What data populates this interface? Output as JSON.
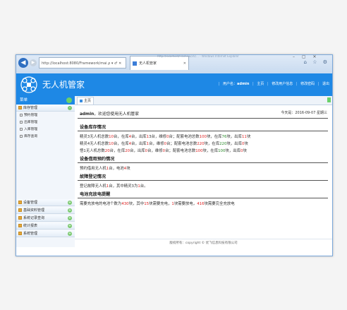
{
  "browser": {
    "address": "http://localhost:8080/Framework/mai ρ ▾ ♂ ✕",
    "tab_title": "无人机管家",
    "window_title": "http://localhost/Framework/... - Windows Internet Explorer",
    "tools_icons": "⌂ ☆ ⚙",
    "window_controls": "– ▢ ✕"
  },
  "header": {
    "app_title": "无人机管家",
    "nav": {
      "user_label": "用户名：",
      "user_name": "admin",
      "home": "主页",
      "edit_info": "修改用户信息",
      "change_password": "修改密码",
      "logout": "退出"
    },
    "brand_color": "#1e88e5"
  },
  "sidebar": {
    "title": "菜单",
    "groups": [
      {
        "label": "库存管理",
        "expanded": true,
        "items": [
          "预约管理",
          "出库管理",
          "入库管理",
          "库存查询"
        ]
      },
      {
        "label": "设备管理"
      },
      {
        "label": "基础资料管理"
      },
      {
        "label": "系统记录查询"
      },
      {
        "label": "统计报表"
      },
      {
        "label": "系统管理"
      }
    ]
  },
  "tabs": [
    {
      "label": "主页"
    }
  ],
  "welcome": {
    "user": "admin",
    "text": "，欢迎您使用无人机管家"
  },
  "today": "今天是：2016-09-07 星期三",
  "sections": {
    "stock": {
      "title": "设备库存情况",
      "lines": [
        [
          {
            "t": "精灵3无人机总数"
          },
          {
            "t": "10",
            "c": "r"
          },
          {
            "t": "台，在库"
          },
          {
            "t": "4",
            "c": "r"
          },
          {
            "t": "台，出库"
          },
          {
            "t": "1",
            "c": "r"
          },
          {
            "t": "3台，维修"
          },
          {
            "t": "0",
            "c": "r"
          },
          {
            "t": "台；配套电池总数"
          },
          {
            "t": "100",
            "c": "r"
          },
          {
            "t": "块，在库"
          },
          {
            "t": "76",
            "c": "g"
          },
          {
            "t": "块，出库"
          },
          {
            "t": "11",
            "c": "r"
          },
          {
            "t": "块"
          }
        ],
        [
          {
            "t": "精灵4无人机总数"
          },
          {
            "t": "10",
            "c": "r"
          },
          {
            "t": "台，在库"
          },
          {
            "t": "4",
            "c": "r"
          },
          {
            "t": "台，出库"
          },
          {
            "t": "1",
            "c": "r"
          },
          {
            "t": "台，维修"
          },
          {
            "t": "0",
            "c": "r"
          },
          {
            "t": "台；配套电池总数"
          },
          {
            "t": "220",
            "c": "r"
          },
          {
            "t": "块，在库"
          },
          {
            "t": "220",
            "c": "g"
          },
          {
            "t": "块，出库"
          },
          {
            "t": "0",
            "c": "r"
          },
          {
            "t": "块"
          }
        ],
        [
          {
            "t": "悟1无人机总数"
          },
          {
            "t": "20",
            "c": "r"
          },
          {
            "t": "台，在库"
          },
          {
            "t": "20",
            "c": "r"
          },
          {
            "t": "台，出库"
          },
          {
            "t": "0",
            "c": "r"
          },
          {
            "t": "台，维修"
          },
          {
            "t": "0",
            "c": "r"
          },
          {
            "t": "台；配套电池总数"
          },
          {
            "t": "100",
            "c": "r"
          },
          {
            "t": "块，在库"
          },
          {
            "t": "100",
            "c": "g"
          },
          {
            "t": "块，出库"
          },
          {
            "t": "0",
            "c": "r"
          },
          {
            "t": "块"
          }
        ]
      ]
    },
    "reservation": {
      "title": "设备借用预约情况",
      "lines": [
        [
          {
            "t": "预约借用无人机"
          },
          {
            "t": "1",
            "c": "r"
          },
          {
            "t": "台，电池"
          },
          {
            "t": "4",
            "c": "r"
          },
          {
            "t": "块"
          }
        ]
      ]
    },
    "fault": {
      "title": "故障登记情况",
      "lines": [
        [
          {
            "t": "登记故障无人机"
          },
          {
            "t": "1",
            "c": "r"
          },
          {
            "t": "台，其中精灵3为"
          },
          {
            "t": "1",
            "c": "r"
          },
          {
            "t": "台。"
          }
        ]
      ]
    },
    "battery": {
      "title": "电池充放电提醒",
      "lines": [
        [
          {
            "t": "需要充放电的电池个数为"
          },
          {
            "t": "430",
            "c": "r"
          },
          {
            "t": "块，其中"
          },
          {
            "t": "15",
            "c": "r"
          },
          {
            "t": "块需要充电，"
          },
          {
            "t": "1",
            "c": "r"
          },
          {
            "t": "块需要放电，"
          },
          {
            "t": "416",
            "c": "r"
          },
          {
            "t": "块需要完全充放电"
          }
        ]
      ]
    }
  },
  "footer": "版权所有：copyright © 优飞信息科技有限公司"
}
